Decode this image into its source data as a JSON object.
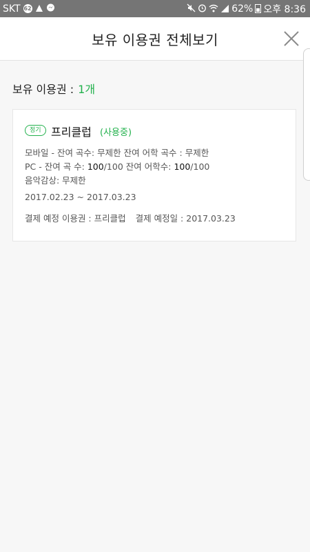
{
  "status_bar": {
    "carrier": "SKT",
    "notification_badge": "62",
    "battery_percent": "62%",
    "time": "오후 8:36"
  },
  "header": {
    "title": "보유 이용권 전체보기"
  },
  "summary": {
    "label": "보유 이용권 :",
    "count": "1개"
  },
  "pass": {
    "tag": "정기",
    "name": "프리클럽",
    "status": "(사용중)",
    "mobile_line": "모바일 - 잔여 곡수: 무제한 잔여 어학 곡수 : 무제한",
    "pc_prefix": "PC - 잔여 곡 수: ",
    "pc_songs_remaining": "100",
    "pc_songs_total": "/100",
    "pc_mid": " 잔여 어학수: ",
    "pc_lang_remaining": "100",
    "pc_lang_total": "/100",
    "music_line": "음악감상: 무제한",
    "period": "2017.02.23 ~ 2017.03.23",
    "payment_pass": "결제 예정 이용권 : 프리클럽",
    "payment_date": "결제 예정일 : 2017.03.23"
  }
}
